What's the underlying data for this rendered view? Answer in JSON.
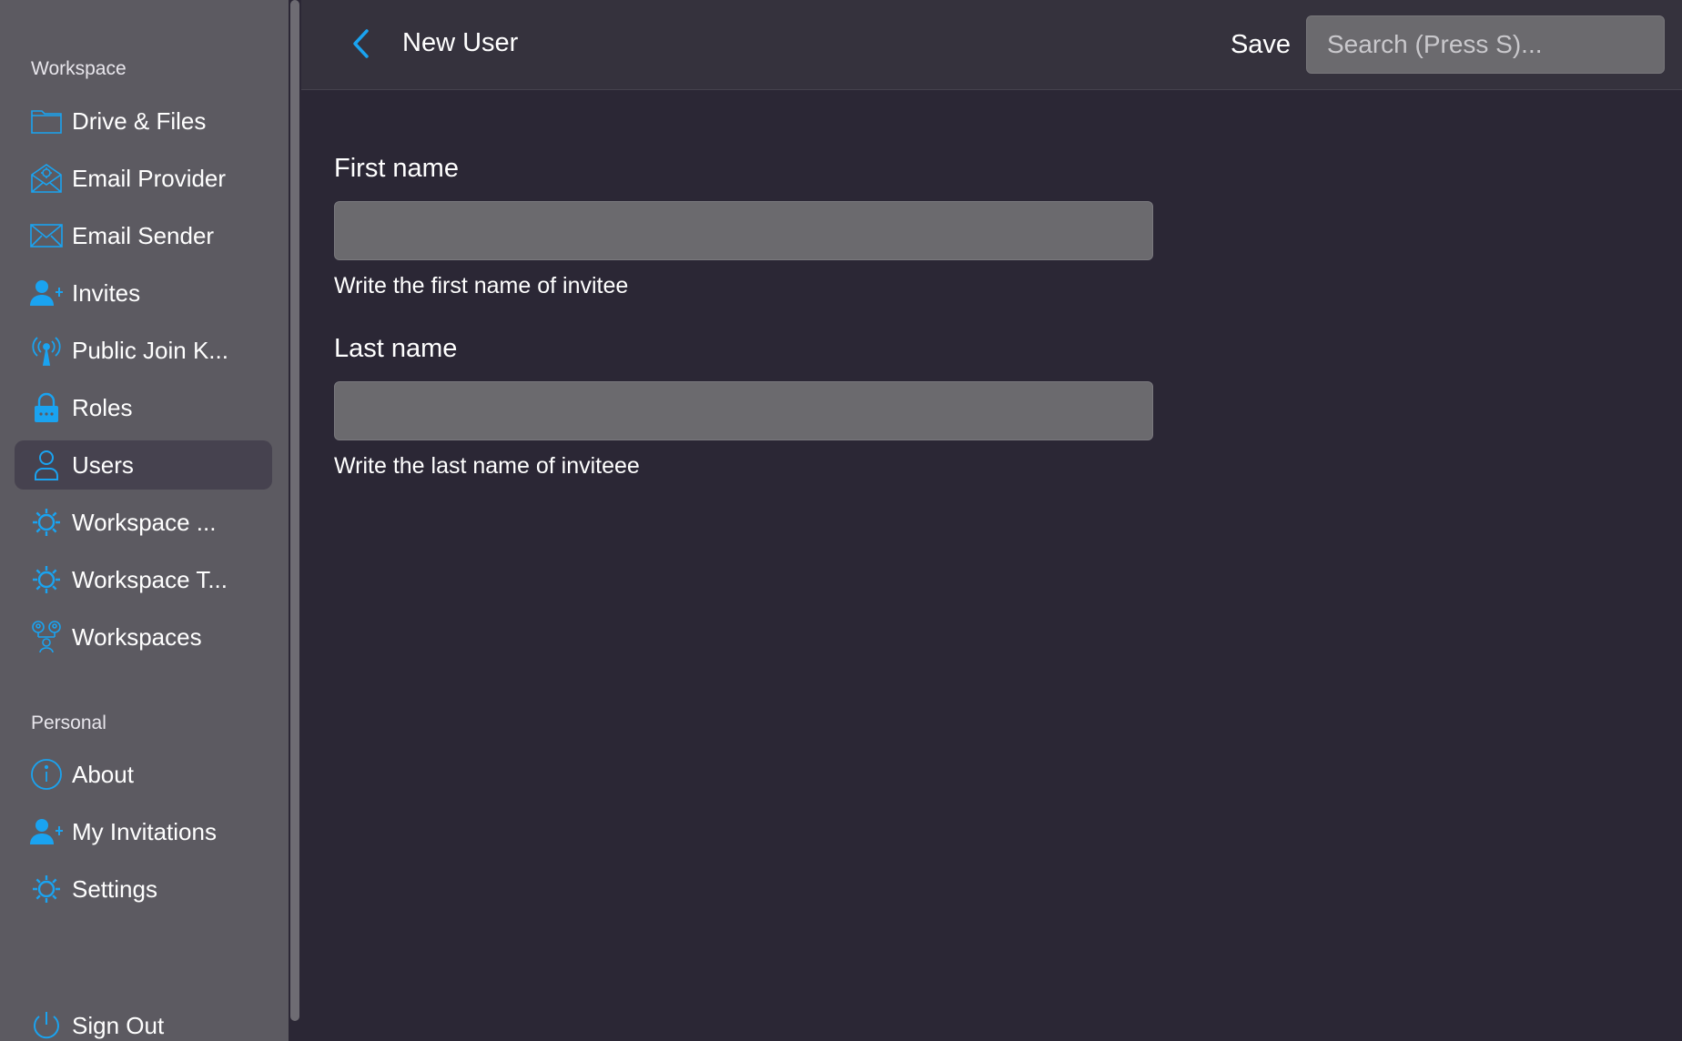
{
  "sidebar": {
    "workspace_section": "Workspace",
    "workspace_items": [
      {
        "label": "Drive & Files",
        "icon": "folder-icon"
      },
      {
        "label": "Email Provider",
        "icon": "email-provider-icon"
      },
      {
        "label": "Email Sender",
        "icon": "envelope-icon"
      },
      {
        "label": "Invites",
        "icon": "user-plus-icon"
      },
      {
        "label": "Public Join K...",
        "icon": "broadcast-icon"
      },
      {
        "label": "Roles",
        "icon": "lock-icon"
      },
      {
        "label": "Users",
        "icon": "user-icon",
        "active": true
      },
      {
        "label": "Workspace ...",
        "icon": "gear-icon"
      },
      {
        "label": "Workspace T...",
        "icon": "gear-icon"
      },
      {
        "label": "Workspaces",
        "icon": "workspaces-icon"
      }
    ],
    "personal_section": "Personal",
    "personal_items": [
      {
        "label": "About",
        "icon": "info-icon"
      },
      {
        "label": "My Invitations",
        "icon": "user-plus-icon"
      },
      {
        "label": "Settings",
        "icon": "gear-icon"
      }
    ],
    "sign_out": {
      "label": "Sign Out",
      "icon": "power-icon"
    }
  },
  "header": {
    "title": "New User",
    "save_label": "Save",
    "search_placeholder": "Search (Press S)..."
  },
  "form": {
    "first_name": {
      "label": "First name",
      "value": "",
      "help": "Write the first name of invitee"
    },
    "last_name": {
      "label": "Last name",
      "value": "",
      "help": "Write the last name of inviteee"
    }
  },
  "colors": {
    "accent": "#1aa3f0",
    "sidebar_bg": "#5c5a61",
    "main_bg": "#2b2735",
    "topbar_bg": "#35323d",
    "active_item_bg": "#46424f",
    "input_bg": "#6b6a6e"
  }
}
